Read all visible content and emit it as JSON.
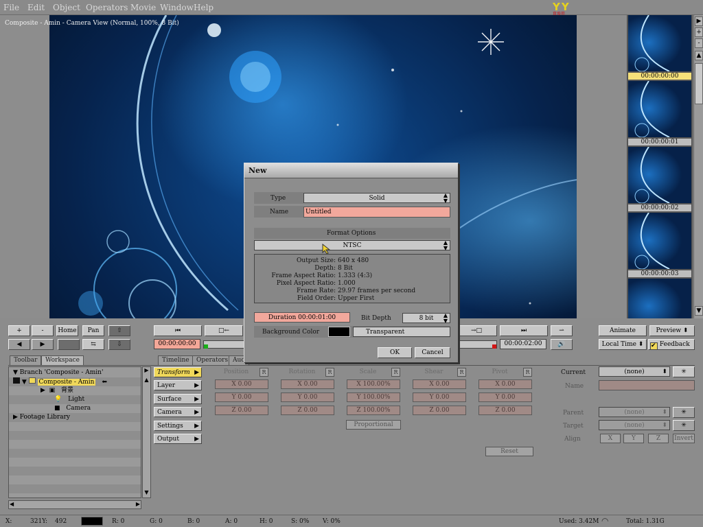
{
  "menu": [
    "File",
    "Edit",
    "Object",
    "Operators",
    "Movie",
    "Window",
    "Help"
  ],
  "logo": {
    "text": "YY",
    "sub": "育埠苑"
  },
  "viewer": {
    "title": "Composite - Amin - Camera View (Normal, 100%, 8 Bit)"
  },
  "filmstrip": {
    "frames": [
      "00:00:00:00",
      "00:00:00:01",
      "00:00:00:02",
      "00:00:00:03"
    ],
    "scroll_buttons": [
      "▶",
      "+",
      "-",
      "▲",
      "▼"
    ]
  },
  "dialog": {
    "title": "New",
    "type_label": "Type",
    "type_value": "Solid",
    "name_label": "Name",
    "name_value": "Untitled",
    "format_options_label": "Format Options",
    "format_value": "NTSC",
    "info": [
      {
        "k": "Output Size:",
        "v": "640 x 480"
      },
      {
        "k": "Depth:",
        "v": "8 Bit"
      },
      {
        "k": "Frame Aspect Ratio:",
        "v": "1.333  (4:3)"
      },
      {
        "k": "Pixel Aspect Ratio:",
        "v": "1.000"
      },
      {
        "k": "Frame Rate:",
        "v": "29.97 frames per second"
      },
      {
        "k": "Field Order:",
        "v": "Upper First"
      }
    ],
    "duration": "Duration 00:00:01:00",
    "bit_depth_label": "Bit Depth",
    "bit_depth_value": "8 bit",
    "bg_color_label": "Background Color",
    "bg_color_value": "Transparent",
    "ok": "OK",
    "cancel": "Cancel"
  },
  "toolbar": {
    "plus": "+",
    "minus": "-",
    "home": "Home",
    "pan": "Pan",
    "current_time": "00:00:00:00",
    "end_time": "00:00:02:00",
    "animate": "Animate",
    "preview": "Preview",
    "local_time": "Local Time",
    "feedback": "Feedback"
  },
  "tabs_left": [
    "Toolbar",
    "Workspace"
  ],
  "tabs_mid": [
    "Timeline",
    "Operators",
    "Aud"
  ],
  "tree": [
    {
      "label": "Branch 'Composite - Amin'"
    },
    {
      "label": "Composite - Amin"
    },
    {
      "label": "背景"
    },
    {
      "label": "Light"
    },
    {
      "label": "Camera"
    },
    {
      "label": "Footage Library"
    }
  ],
  "groups": [
    "Transform",
    "Layer",
    "Surface",
    "Camera",
    "Settings",
    "Output"
  ],
  "transform": {
    "headers": [
      "Position",
      "Rotation",
      "Scale",
      "Shear",
      "Pivot"
    ],
    "r": "R",
    "rows": [
      [
        "X 0.00",
        "X 0.00",
        "X 100.00%",
        "X 0.00",
        "X 0.00"
      ],
      [
        "Y 0.00",
        "Y 0.00",
        "Y 100.00%",
        "Y 0.00",
        "Y 0.00"
      ],
      [
        "Z 0.00",
        "Z 0.00",
        "Z 100.00%",
        "Z 0.00",
        "Z 0.00"
      ]
    ],
    "proportional": "Proportional",
    "reset": "Reset"
  },
  "props": {
    "current_label": "Current",
    "current_value": "(none)",
    "name_label": "Name",
    "parent_label": "Parent",
    "parent_value": "(none)",
    "target_label": "Target",
    "target_value": "(none)",
    "align_label": "Align",
    "align_x": "X",
    "align_y": "Y",
    "align_z": "Z",
    "invert": "Invert"
  },
  "status": {
    "x": "X:",
    "xval": "321Y:",
    "yval": "492",
    "r": "R: 0",
    "g": "G: 0",
    "b": "B: 0",
    "a": "A: 0",
    "h": "H: 0",
    "s": "S: 0%",
    "v": "V: 0%",
    "used": "Used: 3.42M",
    "total": "Total: 1.31G"
  },
  "colors": {
    "accent_yellow": "#f0d85a",
    "pink_field": "#f2a89c",
    "bg": "#8c8c8c"
  }
}
